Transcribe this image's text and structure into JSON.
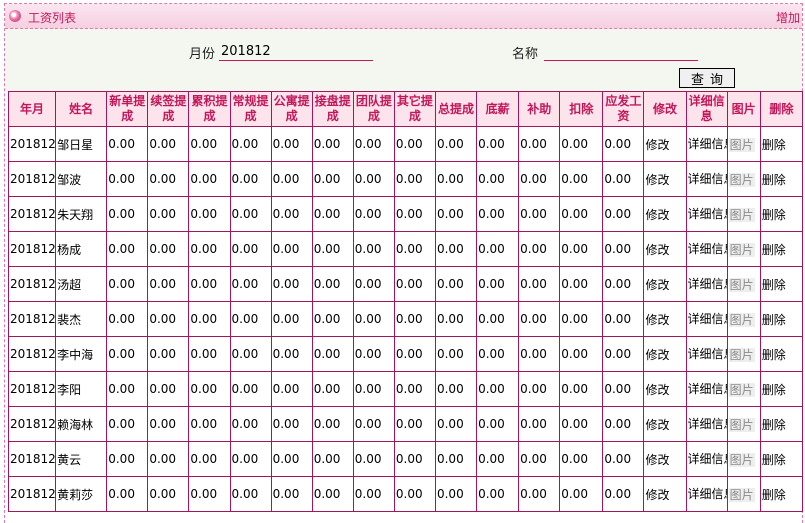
{
  "header": {
    "title": "工资列表",
    "add_label": "增加"
  },
  "search": {
    "month_label": "月份",
    "month_value": "201812",
    "name_label": "名称",
    "name_value": "",
    "query_label": "查询"
  },
  "table": {
    "columns": [
      "年月",
      "姓名",
      "新单提成",
      "续签提成",
      "累积提成",
      "常规提成",
      "公寓提成",
      "接盘提成",
      "团队提成",
      "其它提成",
      "总提成",
      "底薪",
      "补助",
      "扣除",
      "应发工资",
      "修改",
      "详细信息",
      "图片",
      "删除"
    ],
    "rows": [
      {
        "ym": "201812",
        "name": "邹日星",
        "vals": [
          "0.00",
          "0.00",
          "0.00",
          "0.00",
          "0.00",
          "0.00",
          "0.00",
          "0.00",
          "0.00",
          "0.00",
          "0.00",
          "0.00",
          "0.00"
        ]
      },
      {
        "ym": "201812",
        "name": "邹波",
        "vals": [
          "0.00",
          "0.00",
          "0.00",
          "0.00",
          "0.00",
          "0.00",
          "0.00",
          "0.00",
          "0.00",
          "0.00",
          "0.00",
          "0.00",
          "0.00"
        ]
      },
      {
        "ym": "201812",
        "name": "朱天翔",
        "vals": [
          "0.00",
          "0.00",
          "0.00",
          "0.00",
          "0.00",
          "0.00",
          "0.00",
          "0.00",
          "0.00",
          "0.00",
          "0.00",
          "0.00",
          "0.00"
        ]
      },
      {
        "ym": "201812",
        "name": "杨成",
        "vals": [
          "0.00",
          "0.00",
          "0.00",
          "0.00",
          "0.00",
          "0.00",
          "0.00",
          "0.00",
          "0.00",
          "0.00",
          "0.00",
          "0.00",
          "0.00"
        ]
      },
      {
        "ym": "201812",
        "name": "汤超",
        "vals": [
          "0.00",
          "0.00",
          "0.00",
          "0.00",
          "0.00",
          "0.00",
          "0.00",
          "0.00",
          "0.00",
          "0.00",
          "0.00",
          "0.00",
          "0.00"
        ]
      },
      {
        "ym": "201812",
        "name": "裴杰",
        "vals": [
          "0.00",
          "0.00",
          "0.00",
          "0.00",
          "0.00",
          "0.00",
          "0.00",
          "0.00",
          "0.00",
          "0.00",
          "0.00",
          "0.00",
          "0.00"
        ]
      },
      {
        "ym": "201812",
        "name": "李中海",
        "vals": [
          "0.00",
          "0.00",
          "0.00",
          "0.00",
          "0.00",
          "0.00",
          "0.00",
          "0.00",
          "0.00",
          "0.00",
          "0.00",
          "0.00",
          "0.00"
        ]
      },
      {
        "ym": "201812",
        "name": "李阳",
        "vals": [
          "0.00",
          "0.00",
          "0.00",
          "0.00",
          "0.00",
          "0.00",
          "0.00",
          "0.00",
          "0.00",
          "0.00",
          "0.00",
          "0.00",
          "0.00"
        ]
      },
      {
        "ym": "201812",
        "name": "赖海林",
        "vals": [
          "0.00",
          "0.00",
          "0.00",
          "0.00",
          "0.00",
          "0.00",
          "0.00",
          "0.00",
          "0.00",
          "0.00",
          "0.00",
          "0.00",
          "0.00"
        ]
      },
      {
        "ym": "201812",
        "name": "黄云",
        "vals": [
          "0.00",
          "0.00",
          "0.00",
          "0.00",
          "0.00",
          "0.00",
          "0.00",
          "0.00",
          "0.00",
          "0.00",
          "0.00",
          "0.00",
          "0.00"
        ]
      },
      {
        "ym": "201812",
        "name": "黄莉莎",
        "vals": [
          "0.00",
          "0.00",
          "0.00",
          "0.00",
          "0.00",
          "0.00",
          "0.00",
          "0.00",
          "0.00",
          "0.00",
          "0.00",
          "0.00",
          "0.00"
        ]
      }
    ],
    "actions": {
      "edit": "修改",
      "detail": "详细信息",
      "image": "图片",
      "delete": "删除"
    }
  },
  "colors": {
    "accent": "#c2185b",
    "header_bg": "#fde4ec",
    "search_bg": "#f3f7f0",
    "border": "#a0185a"
  },
  "icons": {
    "title": "pink-circle-icon"
  }
}
